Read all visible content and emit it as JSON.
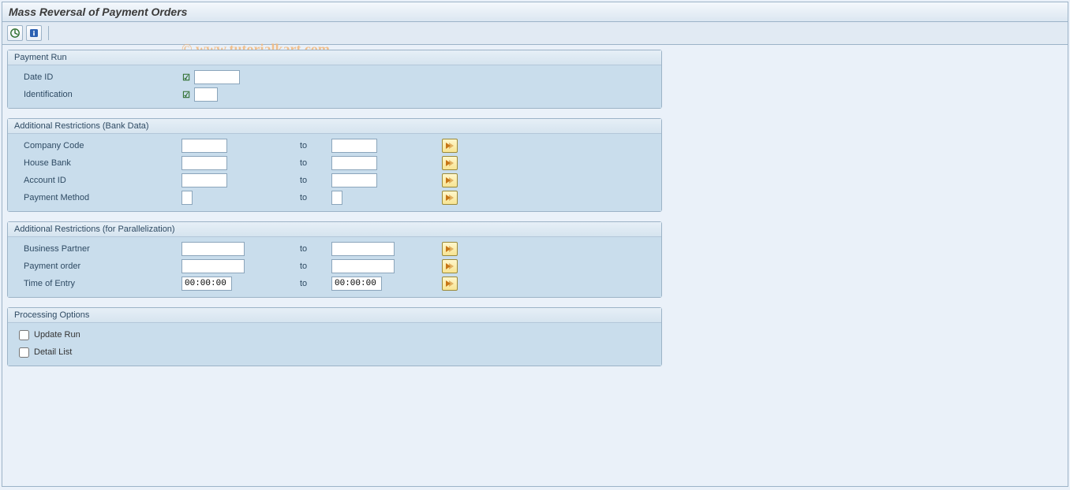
{
  "title": "Mass Reversal of Payment Orders",
  "watermark": "© www.tutorialkart.com",
  "groups": {
    "payment_run": {
      "title": "Payment Run",
      "date_id": {
        "label": "Date ID",
        "value": ""
      },
      "identification": {
        "label": "Identification",
        "value": ""
      }
    },
    "bank_data": {
      "title": "Additional Restrictions (Bank Data)",
      "to_label": "to",
      "company_code": {
        "label": "Company Code",
        "from": "",
        "to": ""
      },
      "house_bank": {
        "label": "House Bank",
        "from": "",
        "to": ""
      },
      "account_id": {
        "label": "Account ID",
        "from": "",
        "to": ""
      },
      "payment_method": {
        "label": "Payment Method",
        "from": "",
        "to": ""
      }
    },
    "parallel": {
      "title": "Additional Restrictions (for Parallelization)",
      "to_label": "to",
      "business_partner": {
        "label": "Business Partner",
        "from": "",
        "to": ""
      },
      "payment_order": {
        "label": "Payment order",
        "from": "",
        "to": ""
      },
      "time_of_entry": {
        "label": "Time of Entry",
        "from": "00:00:00",
        "to": "00:00:00"
      }
    },
    "processing": {
      "title": "Processing Options",
      "update_run": {
        "label": "Update Run",
        "checked": false
      },
      "detail_list": {
        "label": "Detail List",
        "checked": false
      }
    }
  }
}
